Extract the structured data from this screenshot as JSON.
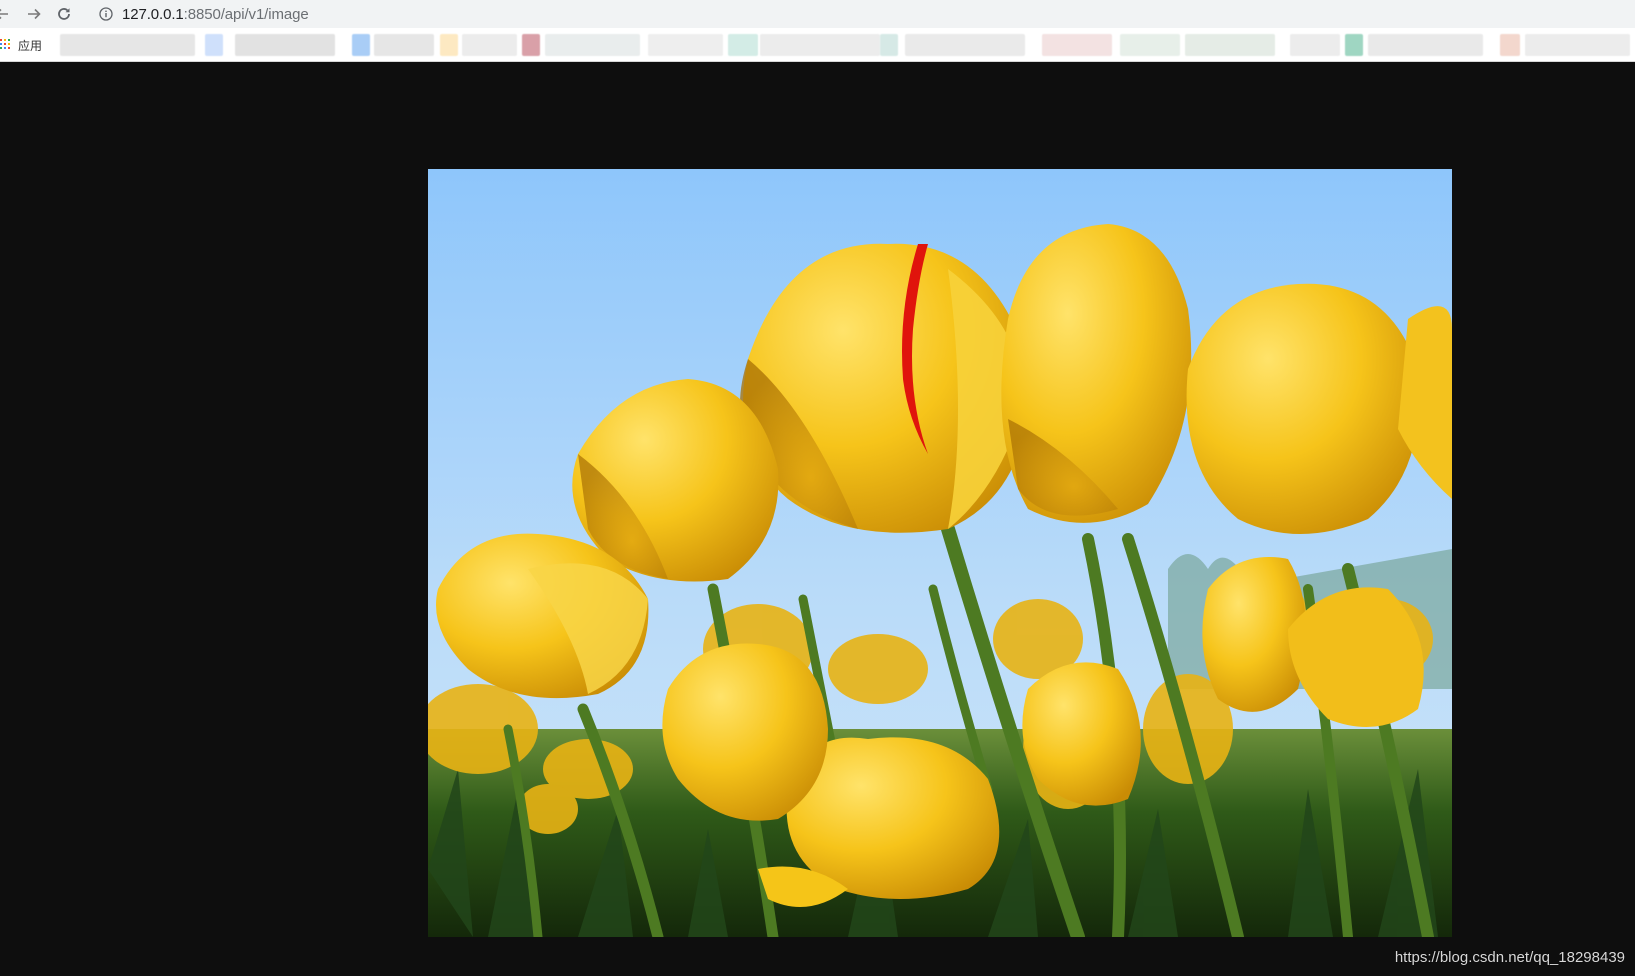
{
  "browser": {
    "url": {
      "host": "127.0.0.1",
      "rest": ":8850/api/v1/image"
    },
    "icons": {
      "back": "back-arrow-icon",
      "forward": "forward-arrow-icon",
      "reload": "reload-icon",
      "site_info": "info-circle-icon"
    }
  },
  "bookmarks_bar": {
    "apps_label": "应用",
    "apps_icon": "apps-grid-icon",
    "apps_icon_colors": [
      "#ea4335",
      "#fbbc05",
      "#34a853",
      "#4285f4",
      "#ea4335",
      "#fbbc05",
      "#34a853",
      "#4285f4",
      "#ea4335"
    ],
    "hidden_items_note": ""
  },
  "content": {
    "image_alt": "tulips",
    "watermark": "https://blog.csdn.net/qq_18298439"
  },
  "colors": {
    "page_background": "#0e0e0e",
    "toolbar_background": "#f1f3f4",
    "sky_top": "#8ec6fb",
    "sky_bottom": "#cfe6f8",
    "tulip_yellow": "#f5c518",
    "tulip_shadow": "#d49a0a",
    "stem_green": "#4d7a22",
    "foliage_dark": "#1e3d12",
    "red_stripe": "#e0140c"
  }
}
